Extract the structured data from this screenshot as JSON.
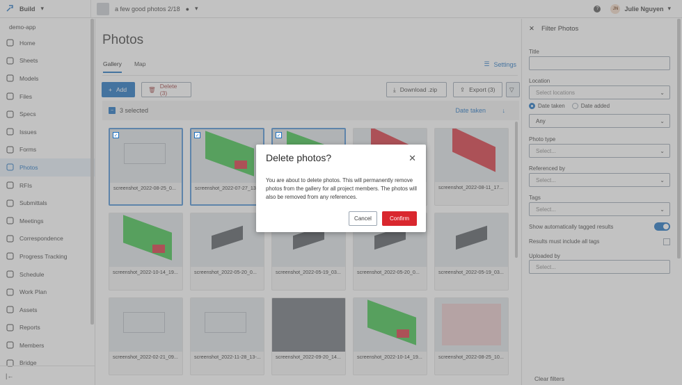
{
  "topbar": {
    "brand": "Build",
    "project": "a few good photos 2/18",
    "user_initials": "JN",
    "user_name": "Julie Nguyen"
  },
  "sidebar": {
    "app_name": "demo-app",
    "items": [
      {
        "label": "Home",
        "icon": "home-icon"
      },
      {
        "label": "Sheets",
        "icon": "sheets-icon"
      },
      {
        "label": "Models",
        "icon": "cube-icon"
      },
      {
        "label": "Files",
        "icon": "file-icon"
      },
      {
        "label": "Specs",
        "icon": "specs-icon"
      },
      {
        "label": "Issues",
        "icon": "issue-icon"
      },
      {
        "label": "Forms",
        "icon": "forms-icon"
      },
      {
        "label": "Photos",
        "icon": "photo-icon"
      },
      {
        "label": "RFIs",
        "icon": "rfi-icon"
      },
      {
        "label": "Submittals",
        "icon": "submittal-icon"
      },
      {
        "label": "Meetings",
        "icon": "meetings-icon"
      },
      {
        "label": "Correspondence",
        "icon": "mail-icon"
      },
      {
        "label": "Progress Tracking",
        "icon": "chart-icon"
      },
      {
        "label": "Schedule",
        "icon": "schedule-icon"
      },
      {
        "label": "Work Plan",
        "icon": "workplan-icon"
      },
      {
        "label": "Assets",
        "icon": "assets-icon"
      },
      {
        "label": "Reports",
        "icon": "reports-icon"
      },
      {
        "label": "Members",
        "icon": "members-icon"
      },
      {
        "label": "Bridge",
        "icon": "bridge-icon"
      }
    ]
  },
  "main": {
    "title": "Photos",
    "tabs": [
      "Gallery",
      "Map"
    ],
    "settings": "Settings",
    "add": "Add",
    "delete": "Delete (3)",
    "download": "Download .zip",
    "export": "Export (3)",
    "selected": "3 selected",
    "sort": "Date taken",
    "photos": [
      "screenshot_2022-08-25_0...",
      "screenshot_2022-07-27_13...",
      "",
      "",
      "screenshot_2022-08-11_17...",
      "screenshot_2022-10-14_19...",
      "screenshot_2022-05-20_0...",
      "screenshot_2022-05-19_03...",
      "screenshot_2022-05-20_0...",
      "screenshot_2022-05-19_03...",
      "screenshot_2022-02-21_09...",
      "screenshot_2022-11-28_13-...",
      "screenshot_2022-09-20_14...",
      "screenshot_2022-10-14_19...",
      "screenshot_2022-08-25_10..."
    ]
  },
  "modal": {
    "title": "Delete photos?",
    "body": "You are about to delete photos. This will permanently remove photos from the gallery for all project members. The photos will also be removed from any references.",
    "cancel": "Cancel",
    "confirm": "Confirm"
  },
  "filter": {
    "header": "Filter Photos",
    "title_label": "Title",
    "location_label": "Location",
    "location_ph": "Select locations",
    "date_taken": "Date taken",
    "date_added": "Date added",
    "date_value": "Any",
    "photo_type_label": "Photo type",
    "referenced_label": "Referenced by",
    "tags_label": "Tags",
    "select_ph": "Select...",
    "auto_tag": "Show automatically tagged results",
    "all_tags": "Results must include all tags",
    "uploaded_label": "Uploaded by",
    "clear": "Clear filters"
  }
}
